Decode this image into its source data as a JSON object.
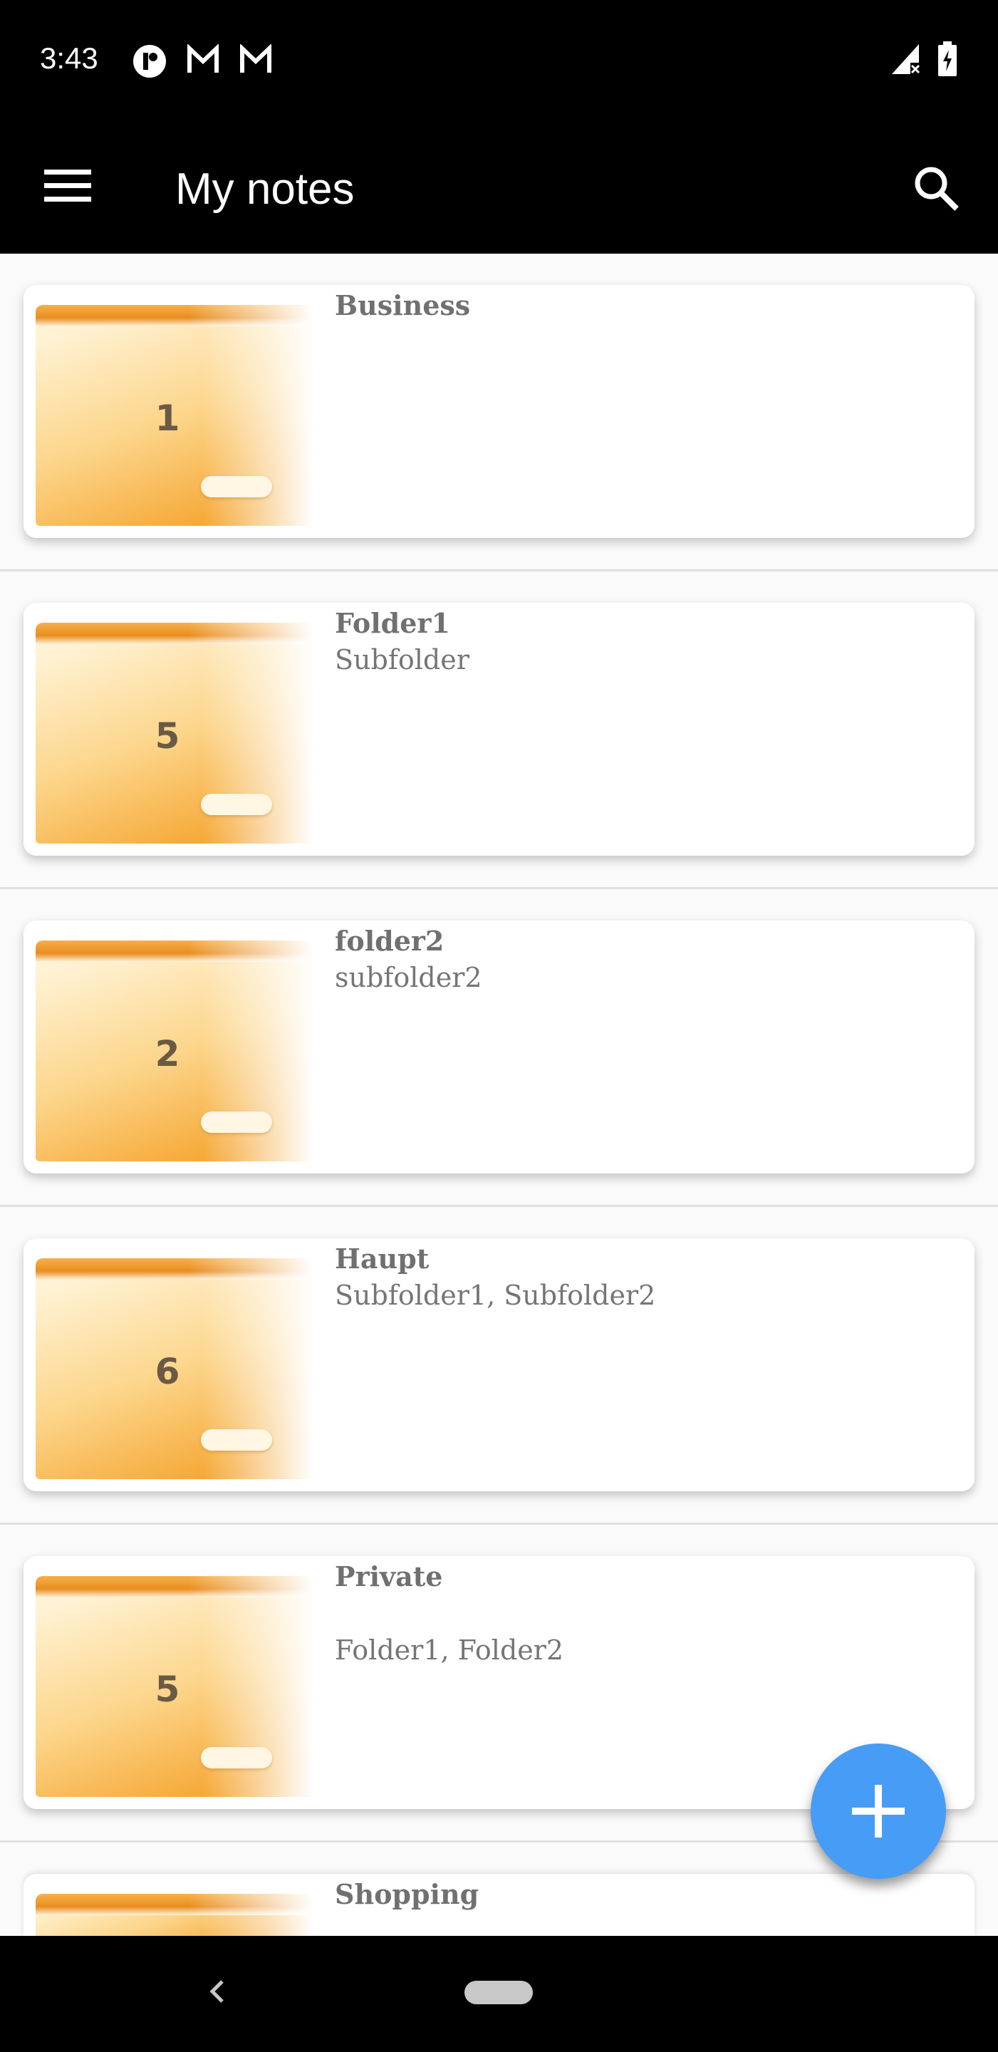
{
  "status_bar": {
    "time": "3:43",
    "icons": [
      "app-notification-icon",
      "gmail-icon",
      "gmail-icon",
      "signal-off-icon",
      "battery-charging-icon"
    ]
  },
  "toolbar": {
    "title": "My notes",
    "menu_icon": "hamburger-menu-icon",
    "search_icon": "search-icon"
  },
  "folders": [
    {
      "name": "Business",
      "count": "1",
      "subfolders": ""
    },
    {
      "name": "Folder1",
      "count": "5",
      "subfolders": "Subfolder"
    },
    {
      "name": "folder2",
      "count": "2",
      "subfolders": "subfolder2"
    },
    {
      "name": "Haupt",
      "count": "6",
      "subfolders": "Subfolder1, Subfolder2"
    },
    {
      "name": "Private",
      "count": "5",
      "subfolders": "Folder1, Folder2"
    },
    {
      "name": "Shopping",
      "count": "",
      "subfolders": ""
    }
  ],
  "fab": {
    "icon": "plus-icon",
    "color": "#479cf5"
  },
  "nav_bar": {
    "back_icon": "back-chevron-icon",
    "home_icon": "home-pill-icon"
  }
}
